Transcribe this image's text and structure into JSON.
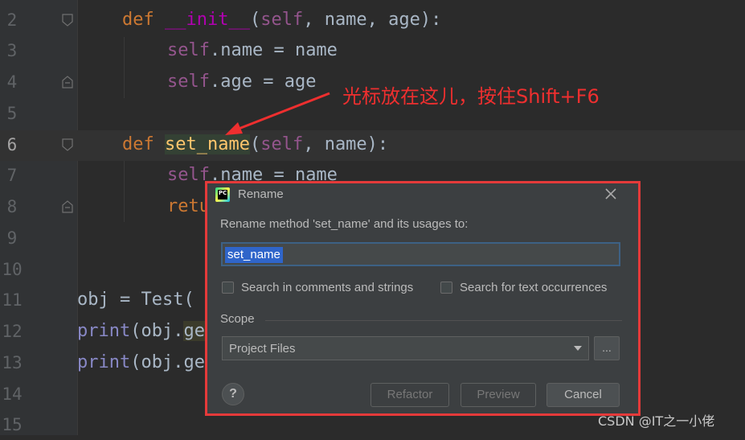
{
  "editor": {
    "line_numbers": [
      "2",
      "3",
      "4",
      "5",
      "6",
      "7",
      "8",
      "9",
      "10",
      "11",
      "12",
      "13",
      "14",
      "15"
    ],
    "current_line": "6",
    "lines": {
      "l2": [
        "def",
        " ",
        "__init__",
        "(",
        "self",
        ", name, age):"
      ],
      "l3": [
        "self",
        ".name = name"
      ],
      "l4": [
        "self",
        ".age = age"
      ],
      "l6": [
        "def",
        " ",
        "set_name",
        "(",
        "self",
        ", name):"
      ],
      "l7": [
        "self",
        ".name = name"
      ],
      "l8": [
        "retu"
      ],
      "l11": [
        "obj = Test("
      ],
      "l12": [
        "print",
        "(obj.",
        "ge"
      ],
      "l13": [
        "print",
        "(obj.ge"
      ]
    }
  },
  "annotation": {
    "text": "光标放在这儿，按住Shift+F6",
    "color": "#ee2f2f"
  },
  "dialog": {
    "title": "Rename",
    "prompt": "Rename method 'set_name' and its usages to:",
    "input_value": "set_name",
    "checkbox_comments": "Search in comments and strings",
    "checkbox_text": "Search for text occurrences",
    "scope_label": "Scope",
    "scope_value": "Project Files",
    "more_label": "...",
    "help_label": "?",
    "refactor_label": "Refactor",
    "preview_label": "Preview",
    "cancel_label": "Cancel",
    "logo_text": "PC"
  },
  "watermark": "CSDN @IT之一小佬",
  "colors": {
    "background": "#2b2b2b",
    "keyword": "#cc7832",
    "function": "#ffc66d",
    "self": "#94558d",
    "builtin": "#8888c6",
    "dialog_bg": "#3c3f41",
    "highlight_box": "#e53a3a"
  }
}
